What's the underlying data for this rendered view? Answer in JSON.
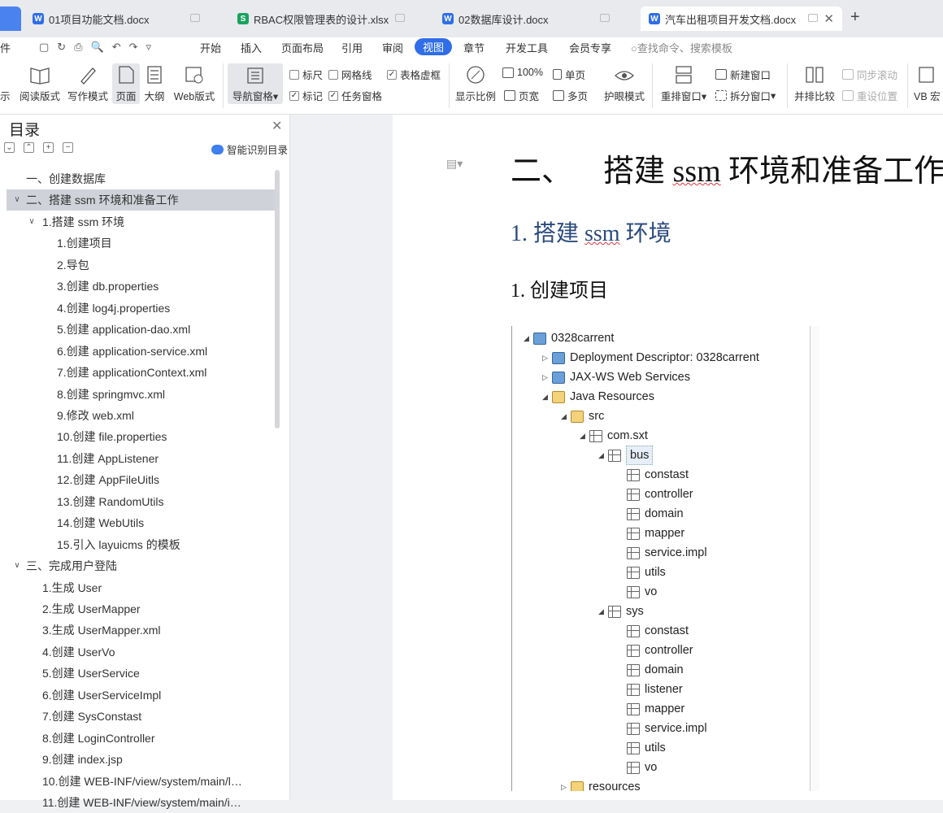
{
  "tabs": [
    {
      "label": "01项目功能文档.docx",
      "type": "W"
    },
    {
      "label": "RBAC权限管理表的设计.xlsx",
      "type": "S"
    },
    {
      "label": "02数据库设计.docx",
      "type": "W"
    },
    {
      "label": "汽车出租项目开发文档.docx",
      "type": "W"
    }
  ],
  "new_tab": "+",
  "menu": {
    "file": "件",
    "items": [
      "开始",
      "插入",
      "页面布局",
      "引用",
      "审阅",
      "视图",
      "章节",
      "开发工具",
      "会员专享"
    ],
    "search": "查找命令、搜索模板"
  },
  "ribbon": {
    "show": "示",
    "read": "阅读版式",
    "write": "写作模式",
    "page": "页面",
    "outline": "大纲",
    "web": "Web版式",
    "nav": "导航窗格",
    "ruler": "标尺",
    "grid": "网格线",
    "table_lines": "表格虚框",
    "marks": "标记",
    "task": "任务窗格",
    "zoom": "显示比例",
    "pct": "100%",
    "single": "单页",
    "width": "页宽",
    "multi": "多页",
    "eye": "护眼模式",
    "rearrange": "重排窗口",
    "newwin": "新建窗口",
    "split": "拆分窗口",
    "compare": "并排比较",
    "sync": "同步滚动",
    "reset": "重设位置",
    "vb": "VB 宏"
  },
  "sidebar": {
    "title": "目录",
    "smart": "智能识别目录",
    "items": [
      {
        "label": "一、创建数据库",
        "level": 1,
        "arrow": ""
      },
      {
        "label": "二、搭建 ssm 环境和准备工作",
        "level": 1,
        "arrow": "v"
      },
      {
        "label": "1.搭建 ssm 环境",
        "level": 2,
        "arrow": "v"
      },
      {
        "label": "1.创建项目",
        "level": 3,
        "arrow": ""
      },
      {
        "label": "2.导包",
        "level": 3,
        "arrow": ""
      },
      {
        "label": "3.创建 db.properties",
        "level": 3,
        "arrow": ""
      },
      {
        "label": "4.创建 log4j.properties",
        "level": 3,
        "arrow": ""
      },
      {
        "label": "5.创建 application-dao.xml",
        "level": 3,
        "arrow": ""
      },
      {
        "label": "6.创建 application-service.xml",
        "level": 3,
        "arrow": ""
      },
      {
        "label": "7.创建 applicationContext.xml",
        "level": 3,
        "arrow": ""
      },
      {
        "label": "8.创建 springmvc.xml",
        "level": 3,
        "arrow": ""
      },
      {
        "label": "9.修改 web.xml",
        "level": 3,
        "arrow": ""
      },
      {
        "label": "10.创建 file.properties",
        "level": 3,
        "arrow": ""
      },
      {
        "label": "11.创建 AppListener",
        "level": 3,
        "arrow": ""
      },
      {
        "label": "12.创建 AppFileUitls",
        "level": 3,
        "arrow": ""
      },
      {
        "label": "13.创建 RandomUtils",
        "level": 3,
        "arrow": ""
      },
      {
        "label": "14.创建 WebUtils",
        "level": 3,
        "arrow": ""
      },
      {
        "label": "15.引入 layuicms 的模板",
        "level": 3,
        "arrow": ""
      },
      {
        "label": "三、完成用户登陆",
        "level": 1,
        "arrow": "v"
      },
      {
        "label": "1.生成 User",
        "level": 2,
        "arrow": ""
      },
      {
        "label": "2.生成 UserMapper",
        "level": 2,
        "arrow": ""
      },
      {
        "label": "3.生成 UserMapper.xml",
        "level": 2,
        "arrow": ""
      },
      {
        "label": "4.创建 UserVo",
        "level": 2,
        "arrow": ""
      },
      {
        "label": "5.创建 UserService",
        "level": 2,
        "arrow": ""
      },
      {
        "label": "6.创建 UserServiceImpl",
        "level": 2,
        "arrow": ""
      },
      {
        "label": "7.创建 SysConstast",
        "level": 2,
        "arrow": ""
      },
      {
        "label": "8.创建 LoginController",
        "level": 2,
        "arrow": ""
      },
      {
        "label": "9.创建 index.jsp",
        "level": 2,
        "arrow": ""
      },
      {
        "label": "10.创建 WEB-INF/view/system/main/l…",
        "level": 2,
        "arrow": ""
      },
      {
        "label": "11.创建 WEB-INF/view/system/main/i…",
        "level": 2,
        "arrow": ""
      }
    ]
  },
  "doc": {
    "h1_prefix": "二、",
    "h1_a": "搭建 ",
    "h1_ssm": "ssm",
    "h1_b": " 环境和准备工作",
    "h2_a": "1. 搭建 ",
    "h2_ssm": "ssm",
    "h2_b": " 环境",
    "h3": "1.  创建项目",
    "tree": [
      {
        "label": "0328carrent",
        "depth": 0,
        "tw": "◢",
        "icon": "proj"
      },
      {
        "label": "Deployment Descriptor: 0328carrent",
        "depth": 1,
        "tw": "▷",
        "icon": "proj"
      },
      {
        "label": "JAX-WS Web Services",
        "depth": 1,
        "tw": "▷",
        "icon": "proj"
      },
      {
        "label": "Java Resources",
        "depth": 1,
        "tw": "◢",
        "icon": "fold"
      },
      {
        "label": "src",
        "depth": 2,
        "tw": "◢",
        "icon": "fold"
      },
      {
        "label": "com.sxt",
        "depth": 3,
        "tw": "◢",
        "icon": "pkg"
      },
      {
        "label": "bus",
        "depth": 4,
        "tw": "◢",
        "icon": "pkg",
        "sel": true
      },
      {
        "label": "constast",
        "depth": 5,
        "tw": "",
        "icon": "pkg"
      },
      {
        "label": "controller",
        "depth": 5,
        "tw": "",
        "icon": "pkg"
      },
      {
        "label": "domain",
        "depth": 5,
        "tw": "",
        "icon": "pkg"
      },
      {
        "label": "mapper",
        "depth": 5,
        "tw": "",
        "icon": "pkg"
      },
      {
        "label": "service.impl",
        "depth": 5,
        "tw": "",
        "icon": "pkg"
      },
      {
        "label": "utils",
        "depth": 5,
        "tw": "",
        "icon": "pkg"
      },
      {
        "label": "vo",
        "depth": 5,
        "tw": "",
        "icon": "pkg"
      },
      {
        "label": "sys",
        "depth": 4,
        "tw": "◢",
        "icon": "pkg"
      },
      {
        "label": "constast",
        "depth": 5,
        "tw": "",
        "icon": "pkg"
      },
      {
        "label": "controller",
        "depth": 5,
        "tw": "",
        "icon": "pkg"
      },
      {
        "label": "domain",
        "depth": 5,
        "tw": "",
        "icon": "pkg"
      },
      {
        "label": "listener",
        "depth": 5,
        "tw": "",
        "icon": "pkg"
      },
      {
        "label": "mapper",
        "depth": 5,
        "tw": "",
        "icon": "pkg"
      },
      {
        "label": "service.impl",
        "depth": 5,
        "tw": "",
        "icon": "pkg"
      },
      {
        "label": "utils",
        "depth": 5,
        "tw": "",
        "icon": "pkg"
      },
      {
        "label": "vo",
        "depth": 5,
        "tw": "",
        "icon": "pkg"
      },
      {
        "label": "resources",
        "depth": 2,
        "tw": "▷",
        "icon": "fold"
      }
    ]
  }
}
